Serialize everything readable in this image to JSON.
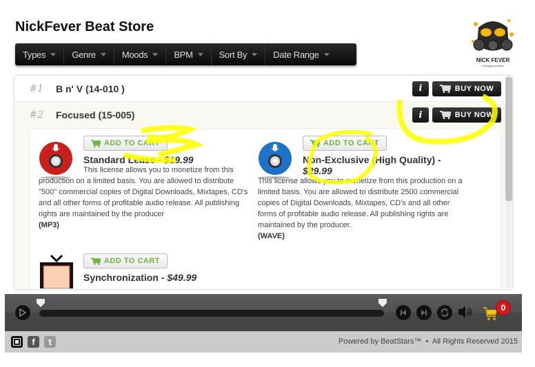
{
  "store": {
    "title": "NickFever Beat Store",
    "logo_text": "NICK FEVER",
    "logo_sub": "Contagious Music"
  },
  "nav": [
    {
      "label": "Types"
    },
    {
      "label": "Genre"
    },
    {
      "label": "Moods"
    },
    {
      "label": "BPM"
    },
    {
      "label": "Sort By"
    },
    {
      "label": "Date Range"
    }
  ],
  "tracks": [
    {
      "num": "#1",
      "name": "B n' V (14-010 )",
      "info": "i",
      "buy": "BUY NOW"
    },
    {
      "num": "#2",
      "name": "Focused (15-005)",
      "info": "i",
      "buy": "BUY NOW"
    }
  ],
  "licenses": [
    {
      "add_label": "ADD TO CART",
      "name": "Standard Lease - ",
      "price": "$19.99",
      "desc": "This license allows you to monetize from this production on a limited basis. You are allowed to distribute \"500\" commercial copies of Digital Downloads, Mixtapes, CD's and all other forms of profitable audio release. All publishing rights are maintained by the producer",
      "format": "(MP3)",
      "icon": "red-cd-icon",
      "color": "#c8201c"
    },
    {
      "add_label": "ADD TO CART",
      "name": "Non-Exclusive (High Quality) - ",
      "price": "$29.99",
      "desc": "This license allows you to monetize from this production on a limited basis. You are allowed to distribute 2500 commercial copies of Digital Downloads, Mixtapes, CD's and all other forms of profitable audio release. All publishing rights are maintained by the producer.",
      "format": "(WAVE)",
      "icon": "blue-cd-icon",
      "color": "#1e73c8"
    },
    {
      "add_label": "ADD TO CART",
      "name": "Synchronization - ",
      "price": "$49.99",
      "icon": "tv-icon"
    }
  ],
  "player": {
    "cart_count": "0"
  },
  "footer": {
    "powered_by": "Powered by ",
    "brand": "BeatStars™",
    "separator": "•",
    "rights": "All Rights Reserved 2015"
  },
  "colors": {
    "accent_green": "#6db33f",
    "badge_red": "#d21a1a",
    "highlight": "#ffff00"
  }
}
